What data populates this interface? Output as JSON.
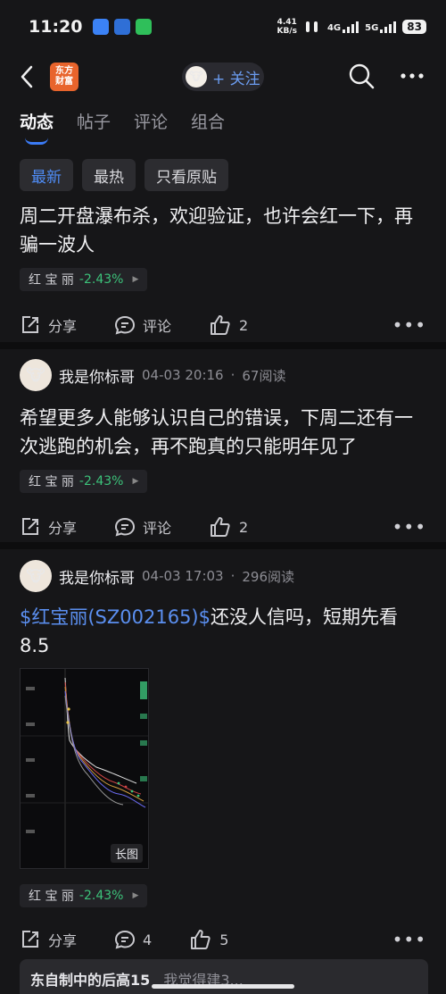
{
  "status": {
    "time": "11:20",
    "net_speed_top": "4.41",
    "net_speed_bottom": "KB/s",
    "sig1": "4G",
    "sig2": "5G",
    "battery": "83"
  },
  "header": {
    "logo_text": "东方财富",
    "follow_label": "+ 关注"
  },
  "tabs": [
    {
      "label": "动态"
    },
    {
      "label": "帖子"
    },
    {
      "label": "评论"
    },
    {
      "label": "组合"
    }
  ],
  "filters": [
    {
      "label": "最新"
    },
    {
      "label": "最热"
    },
    {
      "label": "只看原贴"
    }
  ],
  "posts": [
    {
      "content": "周二开盘瀑布杀，欢迎验证，也许会红一下，再骗一波人",
      "stock": {
        "name": "红 宝 丽",
        "change": "-2.43%"
      },
      "share": "分享",
      "comment": "评论",
      "likes": "2"
    },
    {
      "author": "我是你标哥",
      "time": "04-03 20:16",
      "reads": "67阅读",
      "content": "希望更多人能够认识自己的错误，下周二还有一次逃跑的机会，再不跑真的只能明年见了",
      "stock": {
        "name": "红 宝 丽",
        "change": "-2.43%"
      },
      "share": "分享",
      "comment": "评论",
      "likes": "2"
    },
    {
      "author": "我是你标哥",
      "time": "04-03 17:03",
      "reads": "296阅读",
      "content_link": "$红宝丽(SZ002165)$",
      "content_rest": "还没人信吗，短期先看8.5",
      "image_badge": "长图",
      "stock": {
        "name": "红 宝 丽",
        "change": "-2.43%"
      },
      "share": "分享",
      "comments": "4",
      "likes": "5"
    }
  ],
  "bottom_card": {
    "title": "东自制中的后高15",
    "subtitle": "我觉得建3..."
  },
  "colors": {
    "accent": "#3b7bf5",
    "link": "#5b8ff0",
    "down_green": "#3cc27a",
    "bg": "#161618"
  }
}
